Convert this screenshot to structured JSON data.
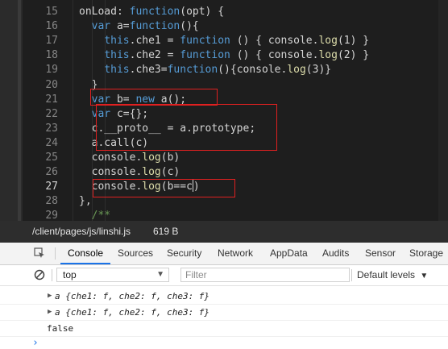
{
  "editor": {
    "lines": [
      {
        "num": "15",
        "parts": [
          [
            "",
            "onLoad: "
          ],
          [
            "kw",
            "function"
          ],
          [
            "",
            "(opt) {"
          ]
        ]
      },
      {
        "num": "16",
        "parts": [
          [
            "",
            "  "
          ],
          [
            "kw",
            "var"
          ],
          [
            "",
            " a="
          ],
          [
            "kw",
            "function"
          ],
          [
            "",
            "(){"
          ]
        ]
      },
      {
        "num": "17",
        "parts": [
          [
            "",
            "    "
          ],
          [
            "kw",
            "this"
          ],
          [
            "",
            ".che1 = "
          ],
          [
            "kw",
            "function"
          ],
          [
            "",
            " () { console."
          ],
          [
            "mth",
            "log"
          ],
          [
            "",
            "(1) }"
          ]
        ]
      },
      {
        "num": "18",
        "parts": [
          [
            "",
            "    "
          ],
          [
            "kw",
            "this"
          ],
          [
            "",
            ".che2 = "
          ],
          [
            "kw",
            "function"
          ],
          [
            "",
            " () { console."
          ],
          [
            "mth",
            "log"
          ],
          [
            "",
            "(2) }"
          ]
        ]
      },
      {
        "num": "19",
        "parts": [
          [
            "",
            "    "
          ],
          [
            "kw",
            "this"
          ],
          [
            "",
            ".che3="
          ],
          [
            "kw",
            "function"
          ],
          [
            "",
            "(){console."
          ],
          [
            "mth",
            "log"
          ],
          [
            "",
            "(3)}"
          ]
        ]
      },
      {
        "num": "20",
        "parts": [
          [
            "",
            "  }"
          ]
        ]
      },
      {
        "num": "21",
        "parts": [
          [
            "",
            "  "
          ],
          [
            "kw",
            "var"
          ],
          [
            "",
            " b= "
          ],
          [
            "kw",
            "new"
          ],
          [
            "",
            " a();"
          ]
        ]
      },
      {
        "num": "22",
        "parts": [
          [
            "",
            "  "
          ],
          [
            "kw",
            "var"
          ],
          [
            "",
            " c={};"
          ]
        ]
      },
      {
        "num": "23",
        "parts": [
          [
            "",
            "  c.__proto__ = a.prototype;"
          ]
        ]
      },
      {
        "num": "24",
        "parts": [
          [
            "",
            "  a.call(c)"
          ]
        ]
      },
      {
        "num": "25",
        "parts": [
          [
            "",
            "  console."
          ],
          [
            "mth",
            "log"
          ],
          [
            "",
            "(b)"
          ]
        ]
      },
      {
        "num": "26",
        "parts": [
          [
            "",
            "  console."
          ],
          [
            "mth",
            "log"
          ],
          [
            "",
            "(c)"
          ]
        ]
      },
      {
        "num": "27",
        "parts": [
          [
            "",
            "  console."
          ],
          [
            "mth",
            "log"
          ],
          [
            "",
            "(b==c)"
          ]
        ],
        "active": true
      },
      {
        "num": "28",
        "parts": [
          [
            "",
            "},"
          ]
        ]
      },
      {
        "num": "29",
        "parts": [
          [
            "",
            "  "
          ],
          [
            "com",
            "/**"
          ]
        ]
      }
    ]
  },
  "file_bar": {
    "path": "/client/pages/js/linshi.js",
    "size": "619 B"
  },
  "tabs": [
    "Console",
    "Sources",
    "Security",
    "Network",
    "AppData",
    "Audits",
    "Sensor",
    "Storage"
  ],
  "toolbar": {
    "context": "top",
    "filter_placeholder": "Filter",
    "levels": "Default levels"
  },
  "console": {
    "rows": [
      {
        "expandable": true,
        "text": "a {che1: f, che2: f, che3: f}"
      },
      {
        "expandable": true,
        "text": "a {che1: f, che2: f, che3: f}"
      },
      {
        "expandable": false,
        "text": "false"
      }
    ],
    "prompt": "›"
  },
  "colors": {
    "keyword": "#569cd6",
    "method": "#dcdcaa",
    "comment": "#6a9955",
    "highlight": "#e02020",
    "accent": "#1a73e8"
  },
  "icons": {
    "inspect": "inspect-element-icon",
    "clear": "clear-console-icon",
    "prompt": "prompt-chevron-icon"
  }
}
